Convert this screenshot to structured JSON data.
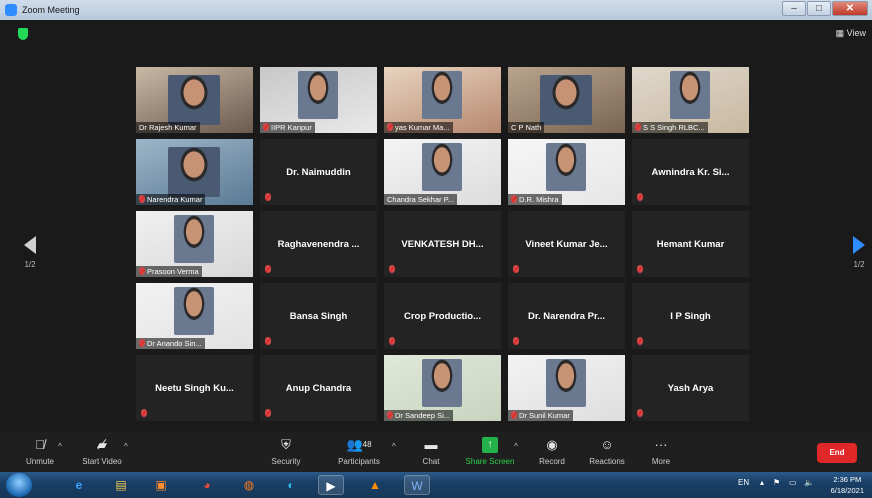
{
  "window": {
    "title": "Zoom Meeting",
    "view_label": "View"
  },
  "navigation": {
    "left_page": "1/2",
    "right_page": "1/2"
  },
  "participants": [
    {
      "name": "Dr Rajesh Kumar",
      "video": true,
      "muted": false
    },
    {
      "name": "IIPR Kanpur",
      "video": true,
      "muted": true
    },
    {
      "name": "yas Kumar Ma...",
      "video": true,
      "muted": true
    },
    {
      "name": "C P Nath",
      "video": true,
      "muted": false,
      "active": true
    },
    {
      "name": "S S Singh RLBC...",
      "video": true,
      "muted": true
    },
    {
      "name": "Narendra Kumar",
      "video": true,
      "muted": true
    },
    {
      "name": "Dr. Naimuddin",
      "video": false,
      "muted": true
    },
    {
      "name": "Chandra Sekhar P...",
      "video": true,
      "muted": false
    },
    {
      "name": "D.R. Mishra",
      "video": true,
      "muted": true
    },
    {
      "name": "Awnindra Kr. Si...",
      "video": false,
      "muted": true
    },
    {
      "name": "Prasoon Verma",
      "video": true,
      "muted": true
    },
    {
      "name": "Raghavenendra ...",
      "video": false,
      "muted": true
    },
    {
      "name": "VENKATESH DH...",
      "video": false,
      "muted": true
    },
    {
      "name": "Vineet Kumar Je...",
      "video": false,
      "muted": true
    },
    {
      "name": "Hemant Kumar",
      "video": false,
      "muted": true
    },
    {
      "name": "Dr Anando Sin...",
      "video": true,
      "muted": true
    },
    {
      "name": "Bansa Singh",
      "video": false,
      "muted": true
    },
    {
      "name": "Crop Productio...",
      "video": false,
      "muted": true
    },
    {
      "name": "Dr. Narendra Pr...",
      "video": false,
      "muted": true
    },
    {
      "name": "I P Singh",
      "video": false,
      "muted": true
    },
    {
      "name": "Neetu Singh Ku...",
      "video": false,
      "muted": true
    },
    {
      "name": "Anup Chandra",
      "video": false,
      "muted": true
    },
    {
      "name": "Dr Sandeep Si...",
      "video": true,
      "muted": true
    },
    {
      "name": "Dr Sunil Kumar",
      "video": true,
      "muted": true
    },
    {
      "name": "Yash Arya",
      "video": false,
      "muted": true
    }
  ],
  "toolbar": {
    "unmute": "Unmute",
    "start_video": "Start Video",
    "security": "Security",
    "participants": "Participants",
    "participants_count": "48",
    "chat": "Chat",
    "share_screen": "Share Screen",
    "record": "Record",
    "reactions": "Reactions",
    "more": "More",
    "end": "End"
  },
  "taskbar": {
    "language": "EN",
    "time": "2:36 PM",
    "date": "6/18/2021"
  },
  "colors": {
    "active_speaker": "#b5d13a",
    "end_button": "#e02828",
    "share_screen": "#2ccf4a",
    "accent": "#2d8cff"
  }
}
